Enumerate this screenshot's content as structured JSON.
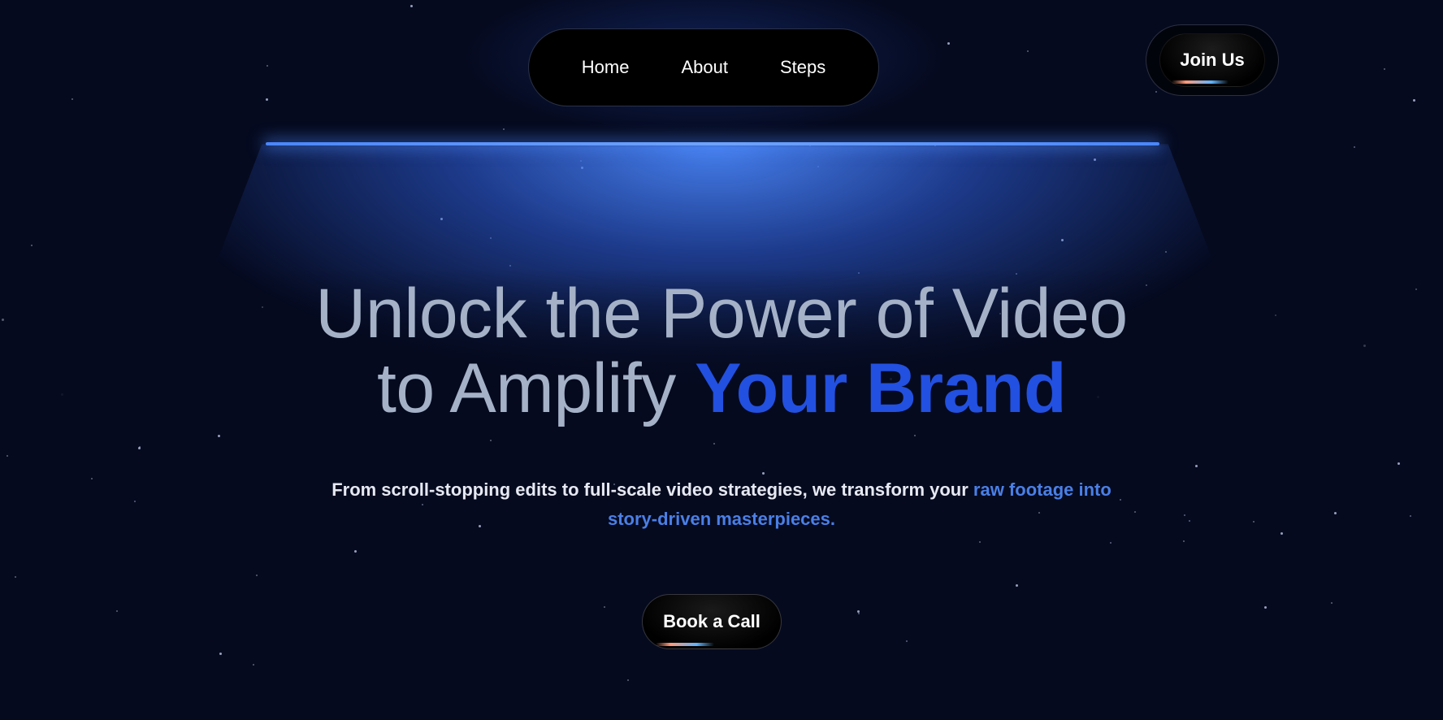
{
  "nav": {
    "items": [
      {
        "label": "Home"
      },
      {
        "label": "About"
      },
      {
        "label": "Steps"
      }
    ]
  },
  "join": {
    "label": "Join Us"
  },
  "hero": {
    "headline_line1": "Unlock the Power of Video",
    "headline_line2_plain": "to Amplify ",
    "headline_line2_accent": "Your Brand",
    "sub_plain": "From scroll-stopping edits to full-scale video strategies, we transform your ",
    "sub_highlight_1": "raw footage into",
    "sub_highlight_2": "story-driven masterpieces."
  },
  "cta": {
    "label": "Book a Call"
  },
  "colors": {
    "background": "#050a1f",
    "beam": "#4a86ff",
    "accent": "#2250e0",
    "highlight": "#4a7fe6",
    "headline": "#a4b1c7"
  }
}
